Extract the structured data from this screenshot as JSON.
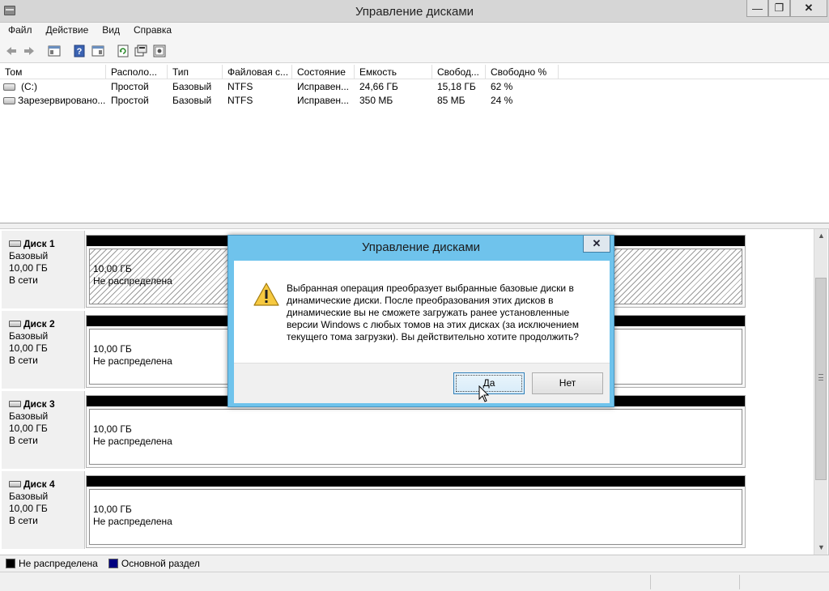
{
  "window": {
    "title": "Управление дисками",
    "minimize_glyph": "—",
    "maximize_glyph": "❐",
    "close_glyph": "✕"
  },
  "menu": [
    "Файл",
    "Действие",
    "Вид",
    "Справка"
  ],
  "toolbar": {
    "icons": [
      "back-arrow-icon",
      "forward-arrow-icon",
      "console-tree-icon",
      "help-icon",
      "properties-icon",
      "refresh-icon",
      "rescan-disks-icon",
      "settings-icon"
    ]
  },
  "volumes": {
    "columns": [
      "Том",
      "Располо...",
      "Тип",
      "Файловая с...",
      "Состояние",
      "Емкость",
      "Свобод...",
      "Свободно %"
    ],
    "rows": [
      [
        "(C:)",
        "Простой",
        "Базовый",
        "NTFS",
        "Исправен...",
        "24,66 ГБ",
        "15,18 ГБ",
        "62 %"
      ],
      [
        "Зарезервировано...",
        "Простой",
        "Базовый",
        "NTFS",
        "Исправен...",
        "350 МБ",
        "85 МБ",
        "24 %"
      ]
    ]
  },
  "disks": [
    {
      "name": "Диск 1",
      "type": "Базовый",
      "size": "10,00 ГБ",
      "status": "В сети",
      "part_size": "10,00 ГБ",
      "part_state": "Не распределена"
    },
    {
      "name": "Диск 2",
      "type": "Базовый",
      "size": "10,00 ГБ",
      "status": "В сети",
      "part_size": "10,00 ГБ",
      "part_state": "Не распределена"
    },
    {
      "name": "Диск 3",
      "type": "Базовый",
      "size": "10,00 ГБ",
      "status": "В сети",
      "part_size": "10,00 ГБ",
      "part_state": "Не распределена"
    },
    {
      "name": "Диск 4",
      "type": "Базовый",
      "size": "10,00 ГБ",
      "status": "В сети",
      "part_size": "10,00 ГБ",
      "part_state": "Не распределена"
    }
  ],
  "legend": [
    {
      "label": "Не распределена",
      "color": "#000000"
    },
    {
      "label": "Основной раздел",
      "color": "#000080"
    }
  ],
  "dialog": {
    "title": "Управление дисками",
    "close_glyph": "✕",
    "icon": "warning-icon",
    "message": "Выбранная операция преобразует выбранные базовые диски в динамические диски. После преобразования этих дисков в динамические вы не сможете загружать ранее установленные версии Windows с любых томов на этих дисках (за исключением текущего тома загрузки). Вы действительно хотите продолжить?",
    "yes_label": "Да",
    "no_label": "Нет"
  },
  "colors": {
    "dialog_frame": "#6fc3ec",
    "titlebar": "#d6d6d6",
    "unallocated_bar": "#000000"
  }
}
